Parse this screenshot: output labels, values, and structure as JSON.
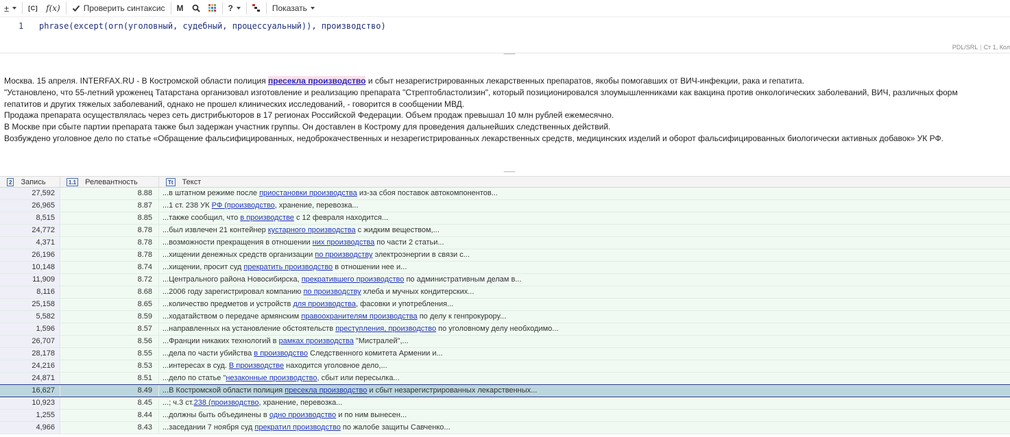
{
  "toolbar": {
    "plusminus": "±",
    "cat_label": "[C]",
    "fx_label": "f(x)",
    "check_label": "Проверить синтаксис",
    "m_label": "M",
    "help_label": "?",
    "show_label": "Показать"
  },
  "editor": {
    "line_number": "1",
    "query": "phrase(except(orn(уголовный, судебный, процессуальный)), производство)",
    "status_mode": "PDL/SRL",
    "status_pos": "Ст 1, Кол"
  },
  "article": {
    "p1_pre": "Москва. 15 апреля. INTERFAX.RU - В Костромской области полиция ",
    "p1_hl": "пресекла производство",
    "p1_post": " и сбыт незарегистрированных лекарственных препаратов, якобы помогавших от ВИЧ-инфекции, рака и гепатита.",
    "p2": "\"Установлено, что 55-летний уроженец Татарстана организовал изготовление и реализацию препарата \"Стрептобластолизин\", который позиционировался злоумышленниками как вакцина против онкологических заболеваний, ВИЧ, различных форм",
    "p3": "гепатитов и других тяжелых заболеваний, однако не прошел клинических исследований, - говорится в сообщении МВД.",
    "p4": "Продажа препарата осуществлялась через сеть дистрибьюторов в 17 регионах Российской Федерации. Объем продаж превышал 10 млн рублей ежемесячно.",
    "p5": "В Москве при сбыте партии препарата также был задержан участник группы. Он доставлен в Кострому для проведения дальнейших следственных действий.",
    "p6": "Возбуждено уголовное дело по статье «Обращение фальсифицированных, недоброкачественных и незарегистрированных лекарственных средств, медицинских изделий и оборот фальсифицированных биологически активных добавок» УК РФ."
  },
  "table": {
    "columns": [
      {
        "icon": "2",
        "label": "Запись"
      },
      {
        "icon": "1.1",
        "label": "Релевантность"
      },
      {
        "icon": "Tt",
        "label": "Текст"
      }
    ],
    "rows": [
      {
        "id": "27,592",
        "rel": "8.88",
        "pre": "...в штатном режиме после ",
        "link": "приостановки производства",
        "post": " из-за сбоя поставок автокомпонентов..."
      },
      {
        "id": "26,965",
        "rel": "8.87",
        "pre": "...1 ст. 238 УК ",
        "link": "РФ (производство",
        "post": ", хранение, перевозка..."
      },
      {
        "id": "8,515",
        "rel": "8.85",
        "pre": "...также сообщил, что ",
        "link": "в производстве",
        "post": " с 12 февраля находится..."
      },
      {
        "id": "24,772",
        "rel": "8.78",
        "pre": "...был извлечен 21 контейнер ",
        "link": "кустарного производства",
        "post": " с жидким веществом,..."
      },
      {
        "id": "4,371",
        "rel": "8.78",
        "pre": "...возможности прекращения в отношении ",
        "link": "них производства",
        "post": " по части 2 статьи..."
      },
      {
        "id": "26,196",
        "rel": "8.78",
        "pre": "...хищении денежных средств организации ",
        "link": "по производству",
        "post": " электроэнергии в связи с..."
      },
      {
        "id": "10,148",
        "rel": "8.74",
        "pre": "...хищении, просит суд ",
        "link": "прекратить производство",
        "post": " в отношении нее и..."
      },
      {
        "id": "11,909",
        "rel": "8.72",
        "pre": "...Центрального района Новосибирска, ",
        "link": "прекратившего производство",
        "post": " по административным делам в..."
      },
      {
        "id": "8,116",
        "rel": "8.68",
        "pre": "...2006 году зарегистрировал компанию ",
        "link": "по производству",
        "post": " хлеба и мучных кондитерских..."
      },
      {
        "id": "25,158",
        "rel": "8.65",
        "pre": "...количество предметов и устройств ",
        "link": "для производства",
        "post": ", фасовки и употребления..."
      },
      {
        "id": "5,582",
        "rel": "8.59",
        "pre": "...ходатайством о передаче армянским ",
        "link": "правоохранителям производства",
        "post": " по делу к генпрокурору..."
      },
      {
        "id": "1,596",
        "rel": "8.57",
        "pre": "...направленных на установление обстоятельств ",
        "link": "преступления, производство",
        "post": " по уголовному делу необходимо..."
      },
      {
        "id": "26,707",
        "rel": "8.56",
        "pre": "...Франции никаких технологий в ",
        "link": "рамках производства",
        "post": " \"Мистралей\",..."
      },
      {
        "id": "28,178",
        "rel": "8.55",
        "pre": "...дела по части убийства ",
        "link": "в производство",
        "post": " Следственного комитета Армении и..."
      },
      {
        "id": "24,216",
        "rel": "8.53",
        "pre": "...интересах в суд. ",
        "link": "В производстве",
        "post": " находится уголовное дело,..."
      },
      {
        "id": "24,871",
        "rel": "8.51",
        "pre": "...дело по статье \"",
        "link": "незаконные производство",
        "post": ", сбыт или пересылка..."
      },
      {
        "id": "16,627",
        "rel": "8.49",
        "pre": "...В Костромской области полиция ",
        "link": "пресекла производство",
        "post": " и сбыт незарегистрированных лекарственных...",
        "selected": true
      },
      {
        "id": "10,923",
        "rel": "8.45",
        "pre": "...; ч.3 ст.",
        "link": "238 (производство",
        "post": ", хранение, перевозка..."
      },
      {
        "id": "1,255",
        "rel": "8.44",
        "pre": "...должны быть объединены в ",
        "link": "одно производство",
        "post": " и по ним вынесен..."
      },
      {
        "id": "4,966",
        "rel": "8.43",
        "pre": "...заседании 7 ноября суд ",
        "link": "прекратил производство",
        "post": " по жалобе защиты Савченко..."
      }
    ]
  },
  "colors": {
    "link": "#2233bb",
    "highlight_bg": "#fbe0ec",
    "row_bg": "#f0faf2",
    "id_bg": "#eeeff7",
    "selected_bg": "#bcd6de",
    "selected_border": "#2c3e8a"
  }
}
